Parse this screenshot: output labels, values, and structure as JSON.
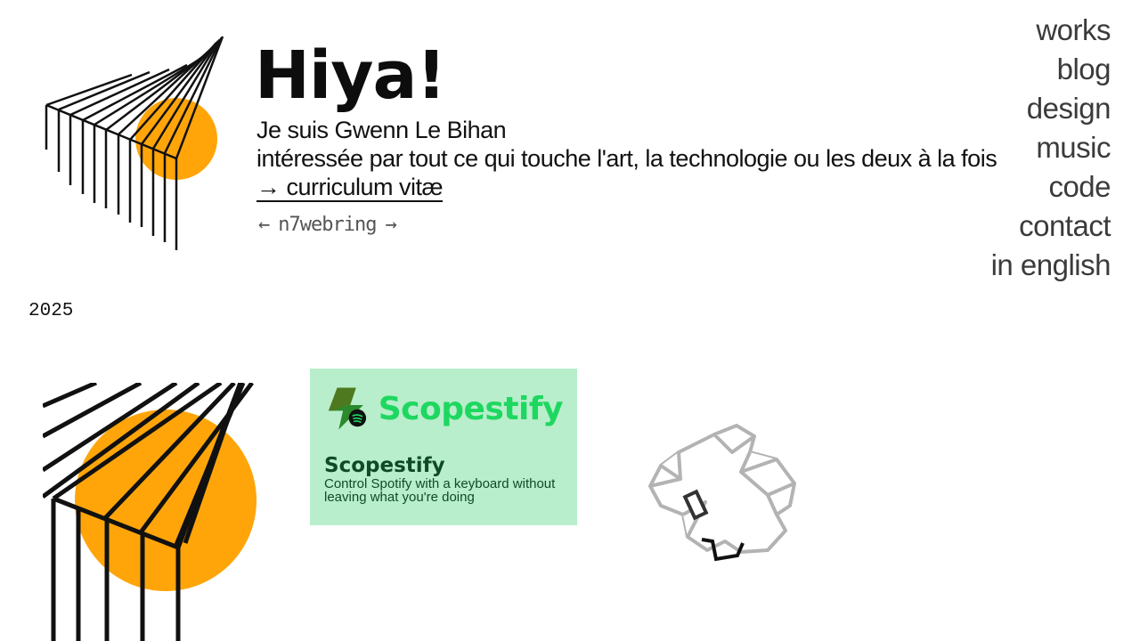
{
  "header": {
    "title": "Hiya!",
    "intro_line1": "Je suis Gwenn Le Bihan",
    "intro_line2": "intéressée par tout ce qui touche l'art, la technologie ou les deux à la fois",
    "cv_link": "→ curriculum vitæ"
  },
  "webring": {
    "prev": "←",
    "name": "n7webring",
    "next": "→"
  },
  "nav": {
    "items": [
      "works",
      "blog",
      "design",
      "music",
      "code",
      "contact",
      "in english"
    ]
  },
  "section": {
    "year": "2025"
  },
  "works": {
    "card": {
      "brand_text": "Scopestify",
      "title": "Scopestify",
      "description": "Control Spotify with a keyboard without leaving what you're doing"
    }
  },
  "colors": {
    "accent_orange": "#ffa50a",
    "card_bg": "#b8eecb",
    "brand_green": "#1ed760",
    "card_text": "#0f4a26"
  }
}
